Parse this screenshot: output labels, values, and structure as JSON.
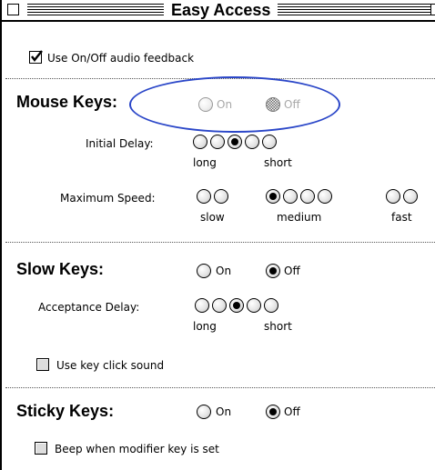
{
  "window": {
    "title": "Easy Access"
  },
  "audio_feedback": {
    "label": "Use On/Off audio feedback",
    "checked": true
  },
  "mouse_keys": {
    "heading": "Mouse Keys:",
    "on_label": "On",
    "off_label": "Off",
    "selected": "Off",
    "disabled": true,
    "initial_delay": {
      "label": "Initial Delay:",
      "min_label": "long",
      "max_label": "short",
      "options": 5,
      "selected_index": 3
    },
    "maximum_speed": {
      "label": "Maximum Speed:",
      "slow_label": "slow",
      "medium_label": "medium",
      "fast_label": "fast",
      "selected_index": 3
    }
  },
  "slow_keys": {
    "heading": "Slow Keys:",
    "on_label": "On",
    "off_label": "Off",
    "selected": "Off",
    "acceptance_delay": {
      "label": "Acceptance Delay:",
      "min_label": "long",
      "max_label": "short",
      "options": 5,
      "selected_index": 3
    },
    "key_click_sound": {
      "label": "Use key click sound",
      "checked": false
    }
  },
  "sticky_keys": {
    "heading": "Sticky Keys:",
    "on_label": "On",
    "off_label": "Off",
    "selected": "Off",
    "beep_modifier": {
      "label": "Beep when modifier key is set",
      "checked": false
    }
  },
  "colors": {
    "annotation": "#2a46c8",
    "dimmed_text": "#a8a8a8"
  }
}
